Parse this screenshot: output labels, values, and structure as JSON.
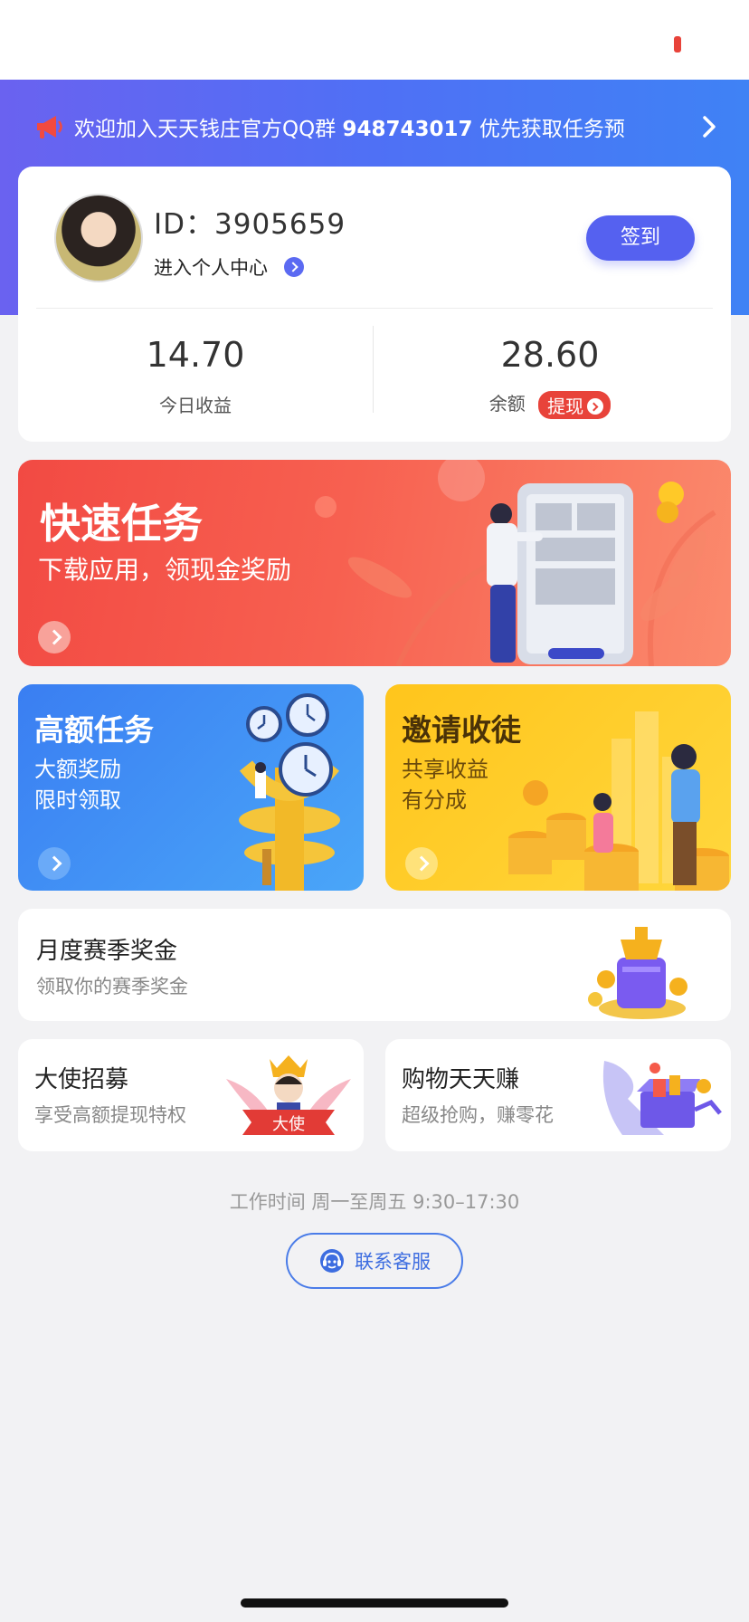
{
  "notice": {
    "text_prefix": "欢迎加入天天钱庄官方QQ群 ",
    "group_number": "948743017",
    "text_suffix": " 优先获取任务预"
  },
  "profile": {
    "id_label": "ID：3905659",
    "center_link": "进入个人中心",
    "signin_label": "签到"
  },
  "stats": {
    "today_value": "14.70",
    "today_label": "今日收益",
    "balance_value": "28.60",
    "balance_label": "余额",
    "withdraw_label": "提现"
  },
  "fast_task": {
    "title": "快速任务",
    "subtitle": "下载应用，领现金奖励"
  },
  "high_task": {
    "title": "高额任务",
    "line1": "大额奖励",
    "line2": "限时领取"
  },
  "invite": {
    "title": "邀请收徒",
    "line1": "共享收益",
    "line2": "有分成"
  },
  "season": {
    "title": "月度赛季奖金",
    "subtitle": "领取你的赛季奖金"
  },
  "ambassador": {
    "title": "大使招募",
    "subtitle": "享受高额提现特权",
    "ribbon": "大使"
  },
  "shopping": {
    "title": "购物天天赚",
    "subtitle": "超级抢购，赚零花"
  },
  "footer": {
    "work_hours": "工作时间 周一至周五 9:30–17:30",
    "service_label": "联系客服"
  },
  "colors": {
    "primary": "#5561f0",
    "red": "#e8433a",
    "blue_tile": "#3a7ef2",
    "yellow_tile": "#ffc51c"
  },
  "icons": [
    "megaphone-icon",
    "chevron-right-icon",
    "customer-service-icon"
  ]
}
